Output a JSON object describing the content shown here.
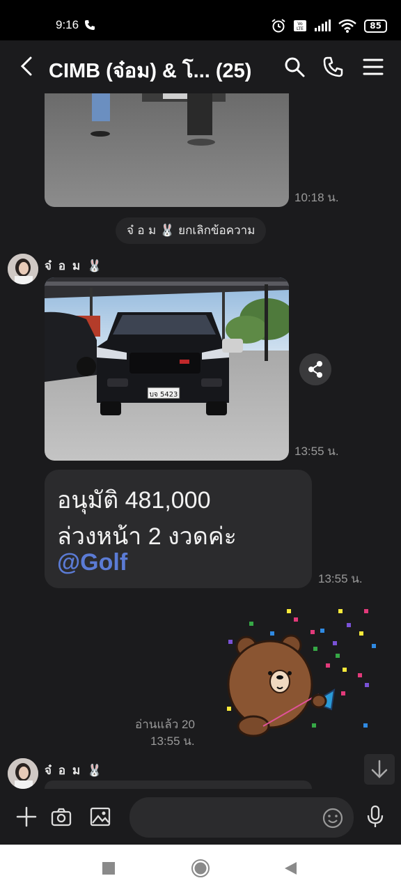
{
  "status_bar": {
    "time": "9:16",
    "battery": "85"
  },
  "header": {
    "title": "CIMB (จ๋อม) & โ... (25)"
  },
  "messages": {
    "first_image_time": "10:18 น.",
    "system_notice": "จ๋ อ ม 🐰 ยกเลิกข้อความ",
    "sender_name": "จ๋ อ ม 🐰",
    "car_photo_time": "13:55 น.",
    "car_plate": "บจ 5423",
    "text_line1": "อนุมัติ 481,000",
    "text_line2": "ล่วงหน้า 2 งวดค่ะ",
    "text_mention": "@Golf",
    "text_time": "13:55 น.",
    "sticker_read": "อ่านแล้ว 20",
    "sticker_time": "13:55 น.",
    "sender_name_2": "จ๋ อ ม 🐰"
  },
  "colors": {
    "background": "#1b1b1d",
    "bubble": "#2b2b2d",
    "mention": "#5b7bd5"
  },
  "icons": [
    "back-icon",
    "search-icon",
    "phone-icon",
    "menu-icon",
    "share-icon",
    "plus-icon",
    "camera-icon",
    "image-icon",
    "emoji-icon",
    "mic-icon",
    "scroll-down-icon",
    "nav-recents-icon",
    "nav-home-icon",
    "nav-back-icon"
  ]
}
